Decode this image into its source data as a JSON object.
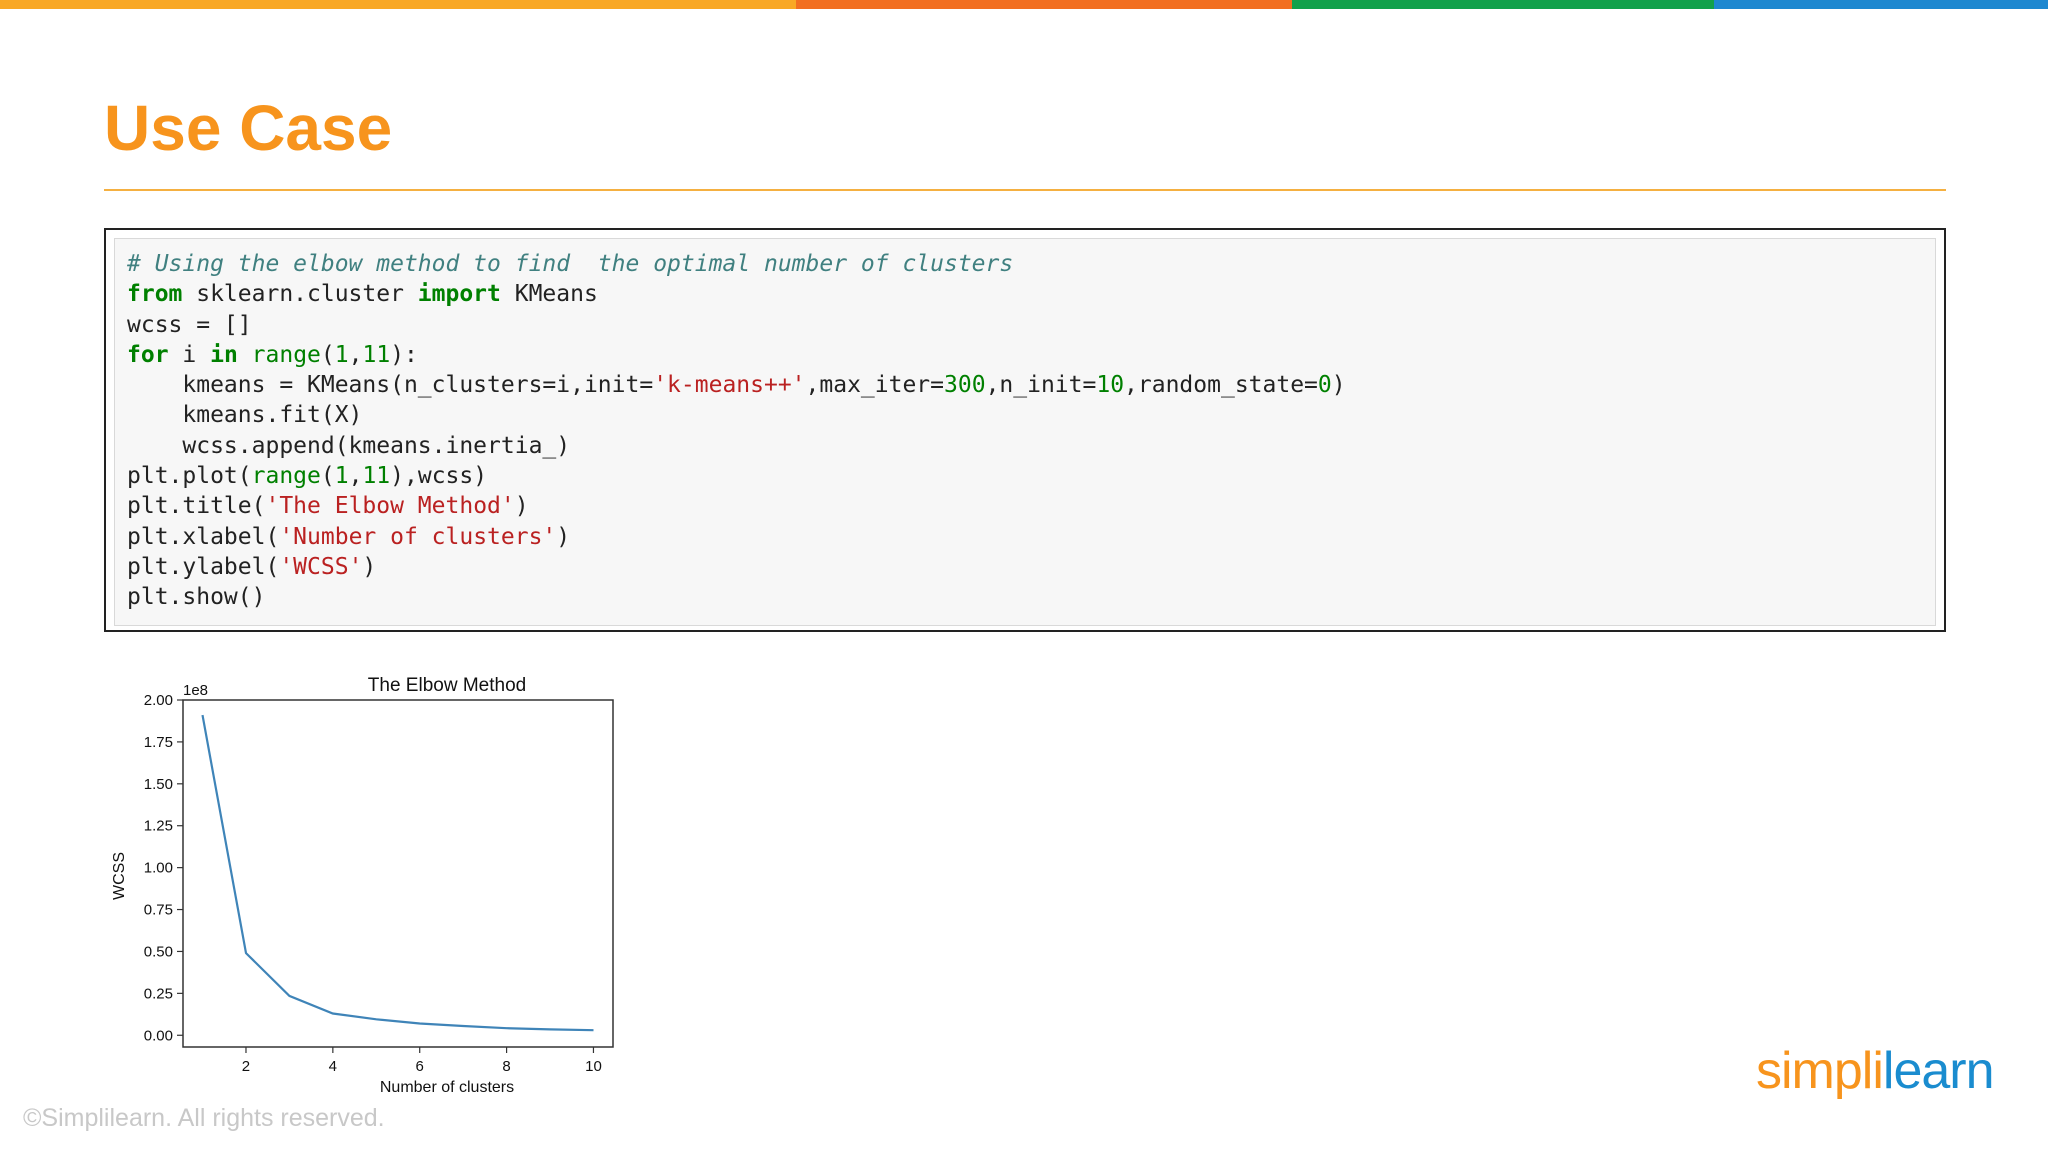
{
  "colors": {
    "accent_orange": "#f7941d",
    "title_rule": "#f5b041",
    "bar_segments": [
      "#f9a825",
      "#f26f21",
      "#12a14b",
      "#1e88d0"
    ],
    "logo_orange": "#f7941d",
    "logo_blue": "#1a8ccf",
    "line_color": "#3f84b8"
  },
  "slide": {
    "title": "Use Case"
  },
  "code": {
    "lines": [
      [
        {
          "t": "# Using the elbow method to find  the optimal number of clusters",
          "c": "cm"
        }
      ],
      [
        {
          "t": "from",
          "c": "kw"
        },
        {
          "t": " sklearn.cluster ",
          "c": ""
        },
        {
          "t": "import",
          "c": "kw"
        },
        {
          "t": " KMeans",
          "c": ""
        }
      ],
      [
        {
          "t": "wcss = []",
          "c": ""
        }
      ],
      [
        {
          "t": "for",
          "c": "kw"
        },
        {
          "t": " i ",
          "c": ""
        },
        {
          "t": "in",
          "c": "kw"
        },
        {
          "t": " ",
          "c": ""
        },
        {
          "t": "range",
          "c": "bi"
        },
        {
          "t": "(",
          "c": ""
        },
        {
          "t": "1",
          "c": "nu"
        },
        {
          "t": ",",
          "c": ""
        },
        {
          "t": "11",
          "c": "nu"
        },
        {
          "t": "):",
          "c": ""
        }
      ],
      [
        {
          "t": "    kmeans = KMeans(n_clusters=i,init=",
          "c": ""
        },
        {
          "t": "'k-means++'",
          "c": "st"
        },
        {
          "t": ",max_iter=",
          "c": ""
        },
        {
          "t": "300",
          "c": "nu"
        },
        {
          "t": ",n_init=",
          "c": ""
        },
        {
          "t": "10",
          "c": "nu"
        },
        {
          "t": ",random_state=",
          "c": ""
        },
        {
          "t": "0",
          "c": "nu"
        },
        {
          "t": ")",
          "c": ""
        }
      ],
      [
        {
          "t": "    kmeans.fit(X)",
          "c": ""
        }
      ],
      [
        {
          "t": "    wcss.append(kmeans.inertia_)",
          "c": ""
        }
      ],
      [
        {
          "t": "plt.plot(",
          "c": ""
        },
        {
          "t": "range",
          "c": "bi"
        },
        {
          "t": "(",
          "c": ""
        },
        {
          "t": "1",
          "c": "nu"
        },
        {
          "t": ",",
          "c": ""
        },
        {
          "t": "11",
          "c": "nu"
        },
        {
          "t": "),wcss)",
          "c": ""
        }
      ],
      [
        {
          "t": "plt.title(",
          "c": ""
        },
        {
          "t": "'The Elbow Method'",
          "c": "st"
        },
        {
          "t": ")",
          "c": ""
        }
      ],
      [
        {
          "t": "plt.xlabel(",
          "c": ""
        },
        {
          "t": "'Number of clusters'",
          "c": "st"
        },
        {
          "t": ")",
          "c": ""
        }
      ],
      [
        {
          "t": "plt.ylabel(",
          "c": ""
        },
        {
          "t": "'WCSS'",
          "c": "st"
        },
        {
          "t": ")",
          "c": ""
        }
      ],
      [
        {
          "t": "plt.show()",
          "c": ""
        }
      ]
    ]
  },
  "chart_data": {
    "type": "line",
    "title": "The Elbow Method",
    "xlabel": "Number of clusters",
    "ylabel": "WCSS",
    "y_offset_label": "1e8",
    "x": [
      1,
      2,
      3,
      4,
      5,
      6,
      7,
      8,
      9,
      10
    ],
    "series": [
      {
        "values": [
          1.91,
          0.49,
          0.235,
          0.13,
          0.095,
          0.07,
          0.055,
          0.042,
          0.035,
          0.03
        ]
      }
    ],
    "xlim": [
      0.55,
      10.45
    ],
    "ylim": [
      -0.07,
      2.0
    ],
    "xticks": [
      2,
      4,
      6,
      8,
      10
    ],
    "xtick_labels": [
      "2",
      "4",
      "6",
      "8",
      "10"
    ],
    "yticks": [
      0.0,
      0.25,
      0.5,
      0.75,
      1.0,
      1.25,
      1.5,
      1.75,
      2.0
    ],
    "ytick_labels": [
      "0.00",
      "0.25",
      "0.50",
      "0.75",
      "1.00",
      "1.25",
      "1.50",
      "1.75",
      "2.00"
    ],
    "grid": false,
    "legend": "none"
  },
  "footer": {
    "copyright": "©Simplilearn. All rights reserved.",
    "logo_part1": "simpl",
    "logo_part2": "i",
    "logo_part3": "learn"
  }
}
